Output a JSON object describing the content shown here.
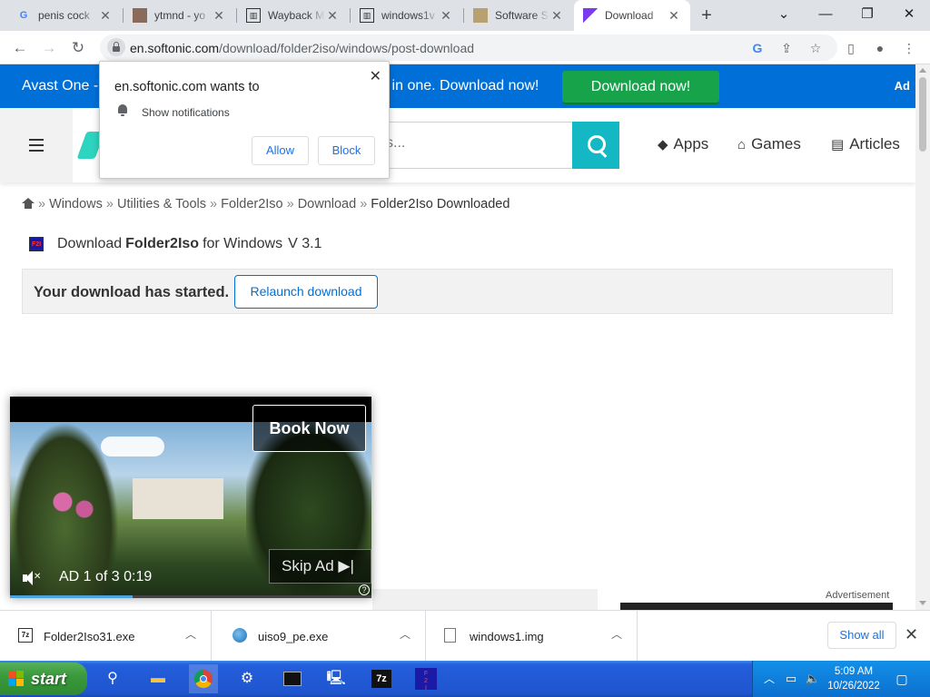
{
  "tabs": [
    {
      "title": "penis cock",
      "icon": "google-icon"
    },
    {
      "title": "ytmnd - yo",
      "icon": "ytmnd-icon"
    },
    {
      "title": "Wayback M",
      "icon": "wayback-icon"
    },
    {
      "title": "windows1v",
      "icon": "wayback-icon"
    },
    {
      "title": "Software S",
      "icon": "software-icon"
    },
    {
      "title": "Download",
      "icon": "softonic-icon",
      "active": true
    }
  ],
  "address": {
    "domain": "en.softonic.com",
    "path": "/download/folder2iso/windows/post-download"
  },
  "banner": {
    "left_text": "Avast One -",
    "right_text": "ll in one. Download now!",
    "button": "Download now!",
    "ad": "Ad"
  },
  "header": {
    "search_placeholder": "s...",
    "nav": [
      {
        "label": "Apps",
        "icon": "apps-icon"
      },
      {
        "label": "Games",
        "icon": "gamepad-icon"
      },
      {
        "label": "Articles",
        "icon": "articles-icon"
      }
    ]
  },
  "breadcrumb": {
    "items": [
      "Windows",
      "Utilities & Tools",
      "Folder2Iso",
      "Download"
    ],
    "current": "Folder2Iso Downloaded",
    "separator": "»"
  },
  "download": {
    "prefix": "Download",
    "app_name": "Folder2Iso",
    "suffix": "for Windows",
    "version": "V 3.1",
    "app_icon_text": "F2I",
    "started_text": "Your download has started.",
    "relaunch": "Relaunch download"
  },
  "notification": {
    "title": "en.softonic.com wants to",
    "desc": "Show notifications",
    "allow": "Allow",
    "block": "Block"
  },
  "video_ad": {
    "book_now": "Book Now",
    "skip": "Skip Ad",
    "ad_info": "AD 1 of 3  0:19",
    "progress": 0.34
  },
  "ad_label": "Advertisement",
  "downloads_shelf": {
    "items": [
      {
        "name": "Folder2Iso31.exe",
        "icon": "7zip-icon"
      },
      {
        "name": "uiso9_pe.exe",
        "icon": "globe-file-icon"
      },
      {
        "name": "windows1.img",
        "icon": "file-icon"
      }
    ],
    "show_all": "Show all"
  },
  "taskbar": {
    "start": "start",
    "time": "5:09 AM",
    "date": "10/26/2022"
  },
  "colors": {
    "banner_blue": "#0070d8",
    "download_green": "#16a34a",
    "search_teal": "#14b8c4"
  }
}
